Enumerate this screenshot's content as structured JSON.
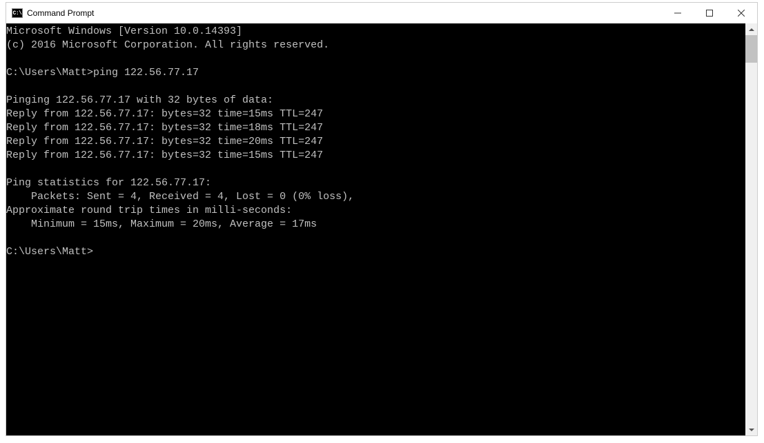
{
  "window": {
    "title": "Command Prompt",
    "icon_label": "C:\\"
  },
  "terminal": {
    "lines": [
      "Microsoft Windows [Version 10.0.14393]",
      "(c) 2016 Microsoft Corporation. All rights reserved.",
      "",
      "C:\\Users\\Matt>ping 122.56.77.17",
      "",
      "Pinging 122.56.77.17 with 32 bytes of data:",
      "Reply from 122.56.77.17: bytes=32 time=15ms TTL=247",
      "Reply from 122.56.77.17: bytes=32 time=18ms TTL=247",
      "Reply from 122.56.77.17: bytes=32 time=20ms TTL=247",
      "Reply from 122.56.77.17: bytes=32 time=15ms TTL=247",
      "",
      "Ping statistics for 122.56.77.17:",
      "    Packets: Sent = 4, Received = 4, Lost = 0 (0% loss),",
      "Approximate round trip times in milli-seconds:",
      "    Minimum = 15ms, Maximum = 20ms, Average = 17ms",
      "",
      "C:\\Users\\Matt>"
    ]
  }
}
